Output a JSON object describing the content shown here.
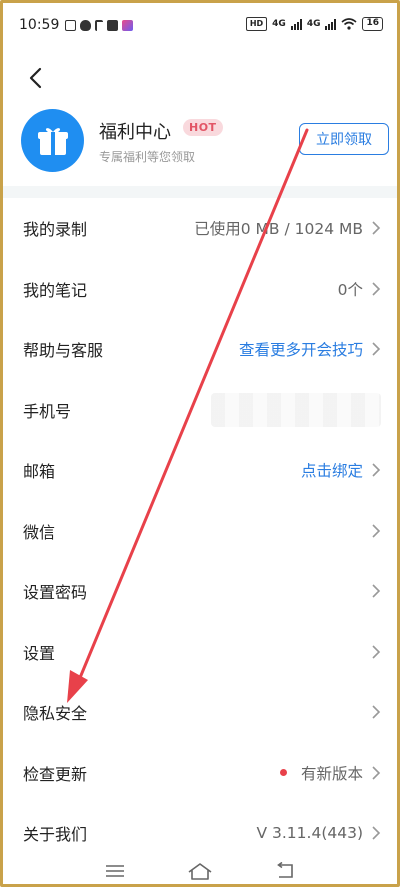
{
  "status_bar": {
    "time": "10:59",
    "net1": "4G",
    "net2": "4G",
    "battery": "16"
  },
  "welfare": {
    "title": "福利中心",
    "badge": "HOT",
    "subtitle": "专属福利等您领取",
    "claim_label": "立即领取"
  },
  "rows": [
    {
      "label": "我的录制",
      "value": "已使用0 MB / 1024 MB",
      "style": "gray"
    },
    {
      "label": "我的笔记",
      "value": "0个",
      "style": "gray"
    },
    {
      "label": "帮助与客服",
      "value": "查看更多开会技巧",
      "style": "blue"
    },
    {
      "label": "手机号",
      "value": "",
      "style": "blur"
    },
    {
      "label": "邮箱",
      "value": "点击绑定",
      "style": "blue"
    },
    {
      "label": "微信",
      "value": "",
      "style": "gray"
    },
    {
      "label": "设置密码",
      "value": "",
      "style": "gray"
    },
    {
      "label": "设置",
      "value": "",
      "style": "gray"
    },
    {
      "label": "隐私安全",
      "value": "",
      "style": "gray"
    },
    {
      "label": "检查更新",
      "value": "有新版本",
      "style": "dot"
    },
    {
      "label": "关于我们",
      "value": "V 3.11.4(443)",
      "style": "gray"
    }
  ],
  "colors": {
    "accent": "#2a7de1",
    "annotation_arrow": "#e8414a",
    "hot_bg": "#f9d9dd",
    "hot_text": "#e25566"
  }
}
